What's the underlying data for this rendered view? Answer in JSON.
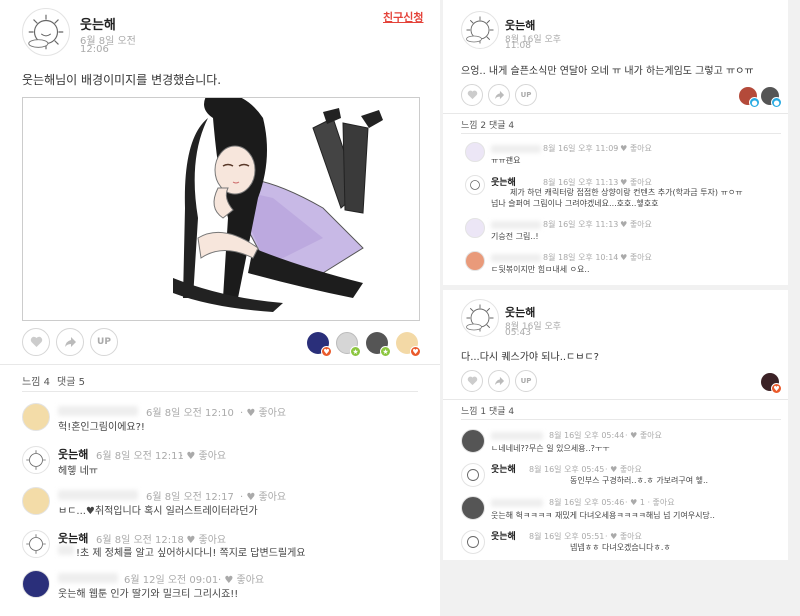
{
  "left_post": {
    "author": "웃는해",
    "date": "6월 8일 오전",
    "time": "12:06",
    "friend_request": "친구신청",
    "text": "웃는해님이 배경이미지를 변경했습니다.",
    "up_label": "UP",
    "stats": {
      "likes": "느낌 4",
      "comments": "댓글 5"
    },
    "comments": [
      {
        "name": "",
        "time": "6월 8일 오전 12:10",
        "like": "좋아요",
        "text": "헉!혼인그림이에요?!"
      },
      {
        "name": "웃는해",
        "time": "6월 8일 오전 12:11",
        "like": "좋아요",
        "text": "헤헿 네ㅠ"
      },
      {
        "name": "",
        "time": "6월 8일 오전 12:17",
        "like": "좋아요",
        "text": "ㅂㄷ...♥취적입니다 혹시 일러스트레이터라던가"
      },
      {
        "name": "웃는해",
        "time": "6월 8일 오전 12:18",
        "like": "좋아요",
        "text": "!초 제 정체를 알고 싶어하시다니! 쪽지로 답변드릴게요"
      },
      {
        "name": "",
        "time": "6월 12일 오전 09:01",
        "like": "좋아요",
        "text": "웃는해 웹툰 인가 딸기와 밀크티 그리시죠!!"
      }
    ]
  },
  "right_post1": {
    "author": "웃는해",
    "date": "8월 16일 오후",
    "time": "11:08",
    "text": "으엉.. 내게 슬픈소식만 연달아 오네 ㅠ 내가 하는게임도 그렇고 ㅠㅇㅠ",
    "up_label": "UP",
    "stats": {
      "likes": "느낌 2",
      "comments": "댓글 4"
    },
    "comments": [
      {
        "name": "",
        "time": "8월 16일 오후 11:09",
        "like": "좋아요",
        "text": "ㅠㅠ괜요"
      },
      {
        "name": "웃는해",
        "time": "8월 16일 오후 11:13",
        "like": "좋아요",
        "text": "제가 하던 캐릭터랑 접접한 상향이랑 컨텐츠 추가(학과금 투자) ㅠㅇㅠ",
        "text2": "넘나 슬퍼여 그림이나 그려야겠네요...호호..헿호호"
      },
      {
        "name": "",
        "time": "8월 16일 오후 11:13",
        "like": "좋아요",
        "text": "기승전 그림..!"
      },
      {
        "name": "",
        "time": "8월 18일 오후 10:14",
        "like": "좋아요",
        "text": "ㄷ뒷볶이지만 힘ㅁ내세 ㅇ요.."
      }
    ]
  },
  "right_post2": {
    "author": "웃는해",
    "date": "8월 16일 오후",
    "time": "05:43",
    "text": "다...다시 퀘스가야 되나..ㄷㅂㄷ?",
    "up_label": "UP",
    "stats": {
      "likes": "느낌 1",
      "comments": "댓글 4"
    },
    "comments": [
      {
        "name": "",
        "time": "8월 16일 오후 05:44",
        "like": "좋아요",
        "text": "ㄴ네네네??무슨 일 있으세용..?ㅜㅜ"
      },
      {
        "name": "웃는해",
        "time": "8월 16일 오후 05:45",
        "like": "좋아요",
        "text": "동인부스 구경하러..ㅎ.ㅎ 가보려구여 헿.."
      },
      {
        "name": "",
        "time": "8월 16일 오후 05:46",
        "like": "좋아요",
        "like_count": "1",
        "text": "웃는해 헉ㅋㅋㅋㅋ 재밌게 다녀오세용ㅋㅋㅋㅋ해님 넘 기여우시당.."
      },
      {
        "name": "웃는해",
        "time": "8월 16일 오후 05:51",
        "like": "좋아요",
        "text": "넵넵ㅎㅎ 다녀오겠습니다ㅎ.ㅎ"
      }
    ]
  },
  "icons": {
    "heart": "heart-icon",
    "share": "share-arrow-icon",
    "sun_avatar": "sun-character-icon"
  },
  "colors": {
    "friend_request": "#e4433a",
    "badge_heart": "#ea5a2b",
    "badge_star": "#8cc63f",
    "badge_drop": "#29abe2"
  }
}
